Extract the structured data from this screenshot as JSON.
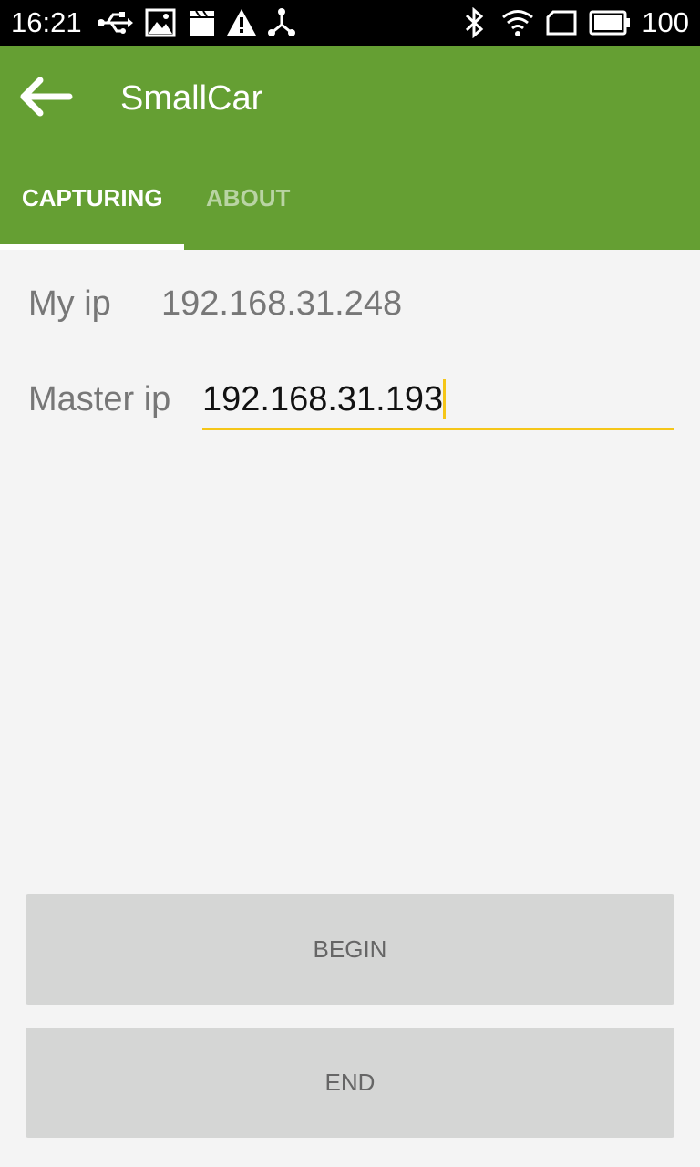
{
  "status_bar": {
    "time": "16:21",
    "left_icons": [
      "usb-icon",
      "image-icon",
      "clapperboard-icon",
      "warning-icon",
      "share-icon"
    ],
    "right_icons": [
      "bluetooth-icon",
      "wifi-icon",
      "screen-rotate-icon",
      "battery-icon"
    ],
    "battery_level": "100"
  },
  "app_bar": {
    "back_icon": "arrow-left-icon",
    "title": "SmallCar",
    "tabs": [
      {
        "label": "CAPTURING",
        "selected": true
      },
      {
        "label": "ABOUT",
        "selected": false
      }
    ],
    "color": "#659f33"
  },
  "form": {
    "my_ip_label": "My ip",
    "my_ip_value": "192.168.31.248",
    "master_ip_label": "Master ip",
    "master_ip_value": "192.168.31.193",
    "input_accent_color": "#f5c618"
  },
  "actions": {
    "begin_label": "BEGIN",
    "end_label": "END"
  }
}
